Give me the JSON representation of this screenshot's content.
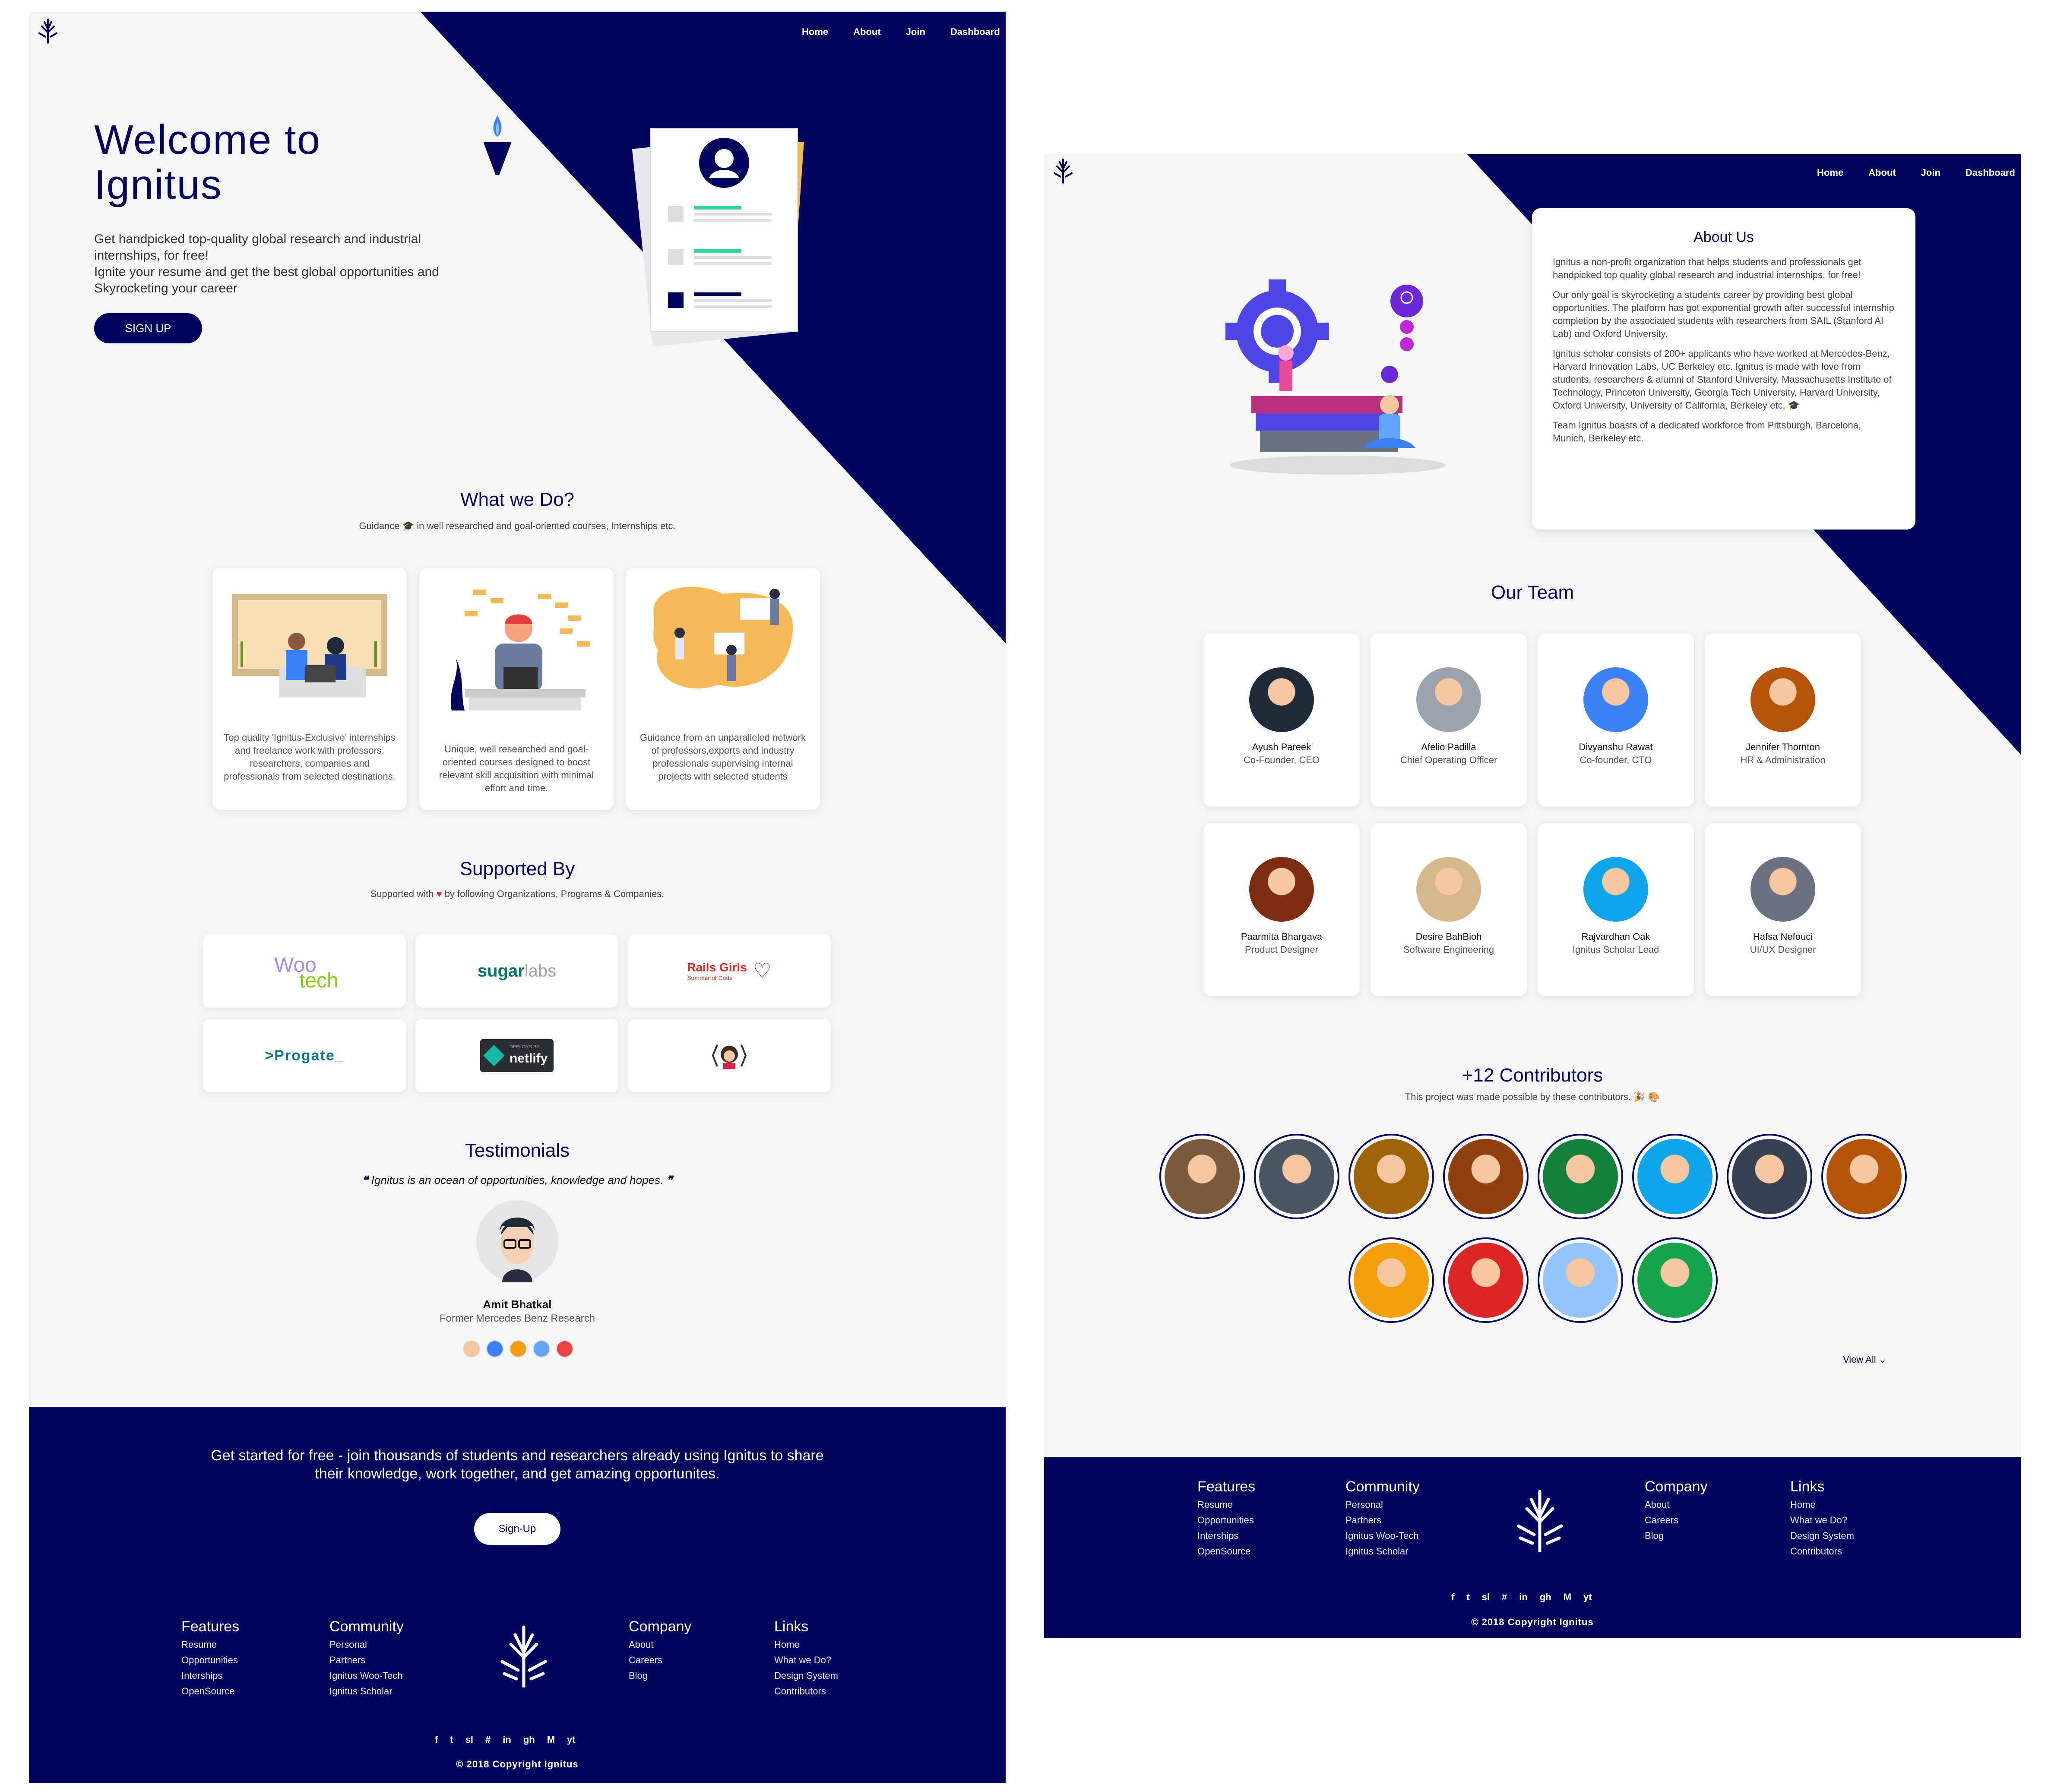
{
  "brand": {
    "logo_icon": "tree-logo-icon",
    "navy": "#03045e",
    "accent_orange": "#f7b955",
    "accent_green": "#34d399"
  },
  "nav": {
    "home": "Home",
    "about": "About",
    "join": "Join",
    "dashboard": "Dashboard"
  },
  "hero": {
    "title_line1": "Welcome to",
    "title_line2": "Ignitus",
    "desc_line1": "Get handpicked top-quality global research and industrial",
    "desc_line2": "internships, for free!",
    "desc_line3": "Ignite your resume and get the best global opportunities and",
    "desc_line4": "Skyrocketing your career",
    "signup": "SIGN UP"
  },
  "what_we_do": {
    "title": "What we Do?",
    "subtitle_pre": "Guidance",
    "subtitle_icon": "graduation-cap-icon",
    "subtitle_post": "in well researched and goal-oriented courses, Internships etc.",
    "cards": [
      {
        "text": "Top quality 'Ignitus-Exclusive' internships and freelance work with professors, researchers, companies and professionals from selected destinations."
      },
      {
        "text": "Unique, well researched and goal-oriented courses designed to boost relevant skill acquisition with minimal effort and time."
      },
      {
        "text": "Guidance from an unparalleled network of professors,experts and industry professionals supervising internal projects with selected students"
      }
    ]
  },
  "supported": {
    "title": "Supported By",
    "subtitle_pre": "Supported with",
    "subtitle_icon": "heart-icon",
    "subtitle_post": "by following Organizations, Programs & Companies.",
    "logos": {
      "woo_1": "Woo",
      "woo_2": "tech",
      "sugar_1": "sugar",
      "sugar_2": "labs",
      "rails_1": "Rails Girls",
      "rails_2": "Summer of Code",
      "progate": "Progate",
      "netlify_1": "DEPLOYS BY",
      "netlify_2": "netlify",
      "women_icon": "woman-coder-icon"
    }
  },
  "testimonials": {
    "title": "Testimonials",
    "quote": "Ignitus is an ocean of opportunities, knowledge and hopes.",
    "name": "Amit Bhatkal",
    "role": "Former Mercedes Benz Research"
  },
  "cta": {
    "line1": "Get started for free - join thousands of students and researchers already using Ignitus to share",
    "line2": "their knowledge, work together, and get amazing opportunites.",
    "button": "Sign-Up"
  },
  "footer": {
    "features": {
      "title": "Features",
      "items": [
        "Resume",
        "Opportunities",
        "Interships",
        "OpenSource"
      ]
    },
    "community": {
      "title": "Community",
      "items": [
        "Personal",
        "Partners",
        "Ignitus Woo-Tech",
        "Ignitus Scholar"
      ]
    },
    "company": {
      "title": "Company",
      "items": [
        "About",
        "Careers",
        "Blog"
      ]
    },
    "links": {
      "title": "Links",
      "items": [
        "Home",
        "What we Do?",
        "Design System",
        "Contributors"
      ]
    },
    "social": [
      "f",
      "t",
      "sl",
      "#",
      "in",
      "gh",
      "M",
      "yt"
    ],
    "copyright": "© 2018 Copyright Ignitus"
  },
  "footer2": {
    "features": {
      "title": "Features",
      "items": [
        "Resume",
        "Opportunities",
        "Interships",
        "OpenSource"
      ]
    },
    "community": {
      "title": "Community",
      "items": [
        "Personal",
        "Partners",
        "Ignitus Woo-Tech",
        "Ignitus Scholar"
      ]
    },
    "company": {
      "title": "Company",
      "items": [
        "About",
        "Careers",
        "Blog"
      ]
    },
    "links": {
      "title": "Links",
      "items": [
        "Home",
        "What we Do?",
        "Design System",
        "Contributors"
      ]
    },
    "copyright": "© 2018 Copyright Ignitus"
  },
  "about": {
    "title": "About Us",
    "p1": "Ignitus a non-profit organization that helps students and professionals get handpicked top quality global research and industrial internships, for free!",
    "p2": "Our only goal is skyrocketing a students career by providing best global opportunities. The platform has got exponential growth after successful internship completion by the associated students with researchers from SAIL (Stanford AI Lab) and Oxford University.",
    "p3": "Ignitus scholar consists of 200+ applicants who have worked at Mercedes-Benz, Harvard Innovation Labs, UC Berkeley etc. Ignitus is made with love from students, researchers & alumni of Stanford University, Massachusetts Institute of Technology, Princeton University, Georgia Tech University, Harvard University, Oxford University, University of California, Berkeley etc.",
    "p4": "Team Ignitus boasts of a dedicated workforce from Pittsburgh, Barcelona, Munich, Berkeley etc."
  },
  "team": {
    "title": "Our Team",
    "members": [
      {
        "name": "Ayush Pareek",
        "role": "Co-Founder, CEO"
      },
      {
        "name": "Afelio Padilla",
        "role": "Chief Operating Officer"
      },
      {
        "name": "Divyanshu Rawat",
        "role": "Co-founder, CTO"
      },
      {
        "name": "Jennifer Thornton",
        "role": "HR & Administration"
      },
      {
        "name": "Paarmita Bhargava",
        "role": "Product Designer"
      },
      {
        "name": "Desire BahBioh",
        "role": "Software Engineering"
      },
      {
        "name": "Rajvardhan Oak",
        "role": "Ignitus Scholar Lead"
      },
      {
        "name": "Hafsa Nefouci",
        "role": "UI/UX Designer"
      }
    ]
  },
  "contributors": {
    "title": "+12 Contributors",
    "subtitle": "This project was made possible by these contributors.",
    "view_all": "View All"
  }
}
